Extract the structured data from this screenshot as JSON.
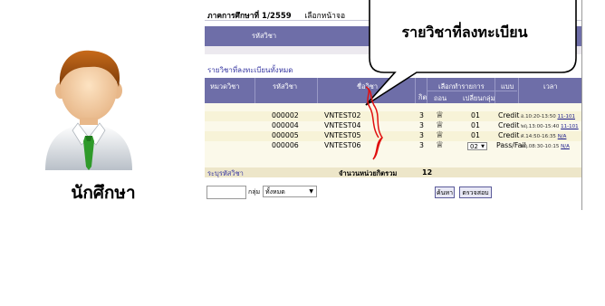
{
  "student": {
    "caption": "นักศึกษา"
  },
  "screen": {
    "term_label": "ภาคการศึกษาที่ 1/2559",
    "term_hint": "เลือกหน้าจอ",
    "top_header": {
      "col_code": "รหัสวิชา"
    },
    "section_title": "รายวิชาที่ลงทะเบียนทั้งหมด",
    "headers": {
      "group": "หมวดวิชา",
      "code": "รหัสวิชา",
      "name": "ชื่อวิชา",
      "credit": "กิต",
      "choose": "เลือกทำรายการ",
      "drop": "ถอน",
      "change_group": "เปลี่ยนกลุ่ม",
      "type": "แบบ",
      "time": "เวลา"
    },
    "rows": [
      {
        "code": "000002",
        "name": "VNTEST02",
        "credit": "3",
        "section": "01",
        "type": "Credit",
        "time_day": "อ.",
        "time": "10:20-13:50",
        "room": "11-101"
      },
      {
        "code": "000004",
        "name": "VNTEST04",
        "credit": "3",
        "section": "01",
        "type": "Credit",
        "time_day": "พฤ.",
        "time": "13:00-15:40",
        "room": "11-101"
      },
      {
        "code": "000005",
        "name": "VNTEST05",
        "credit": "3",
        "section": "01",
        "type": "Credit",
        "time_day": "ศ.",
        "time": "14:50-16:35",
        "room": "N/A"
      },
      {
        "code": "000006",
        "name": "VNTEST06",
        "credit": "3",
        "section": "02",
        "type": "Pass/Fail",
        "time_day": "พฤ.",
        "time": "08:30-10:15",
        "room": "N/A"
      }
    ],
    "footer": {
      "left": "ระบุรหัสวิชา",
      "total_label": "จำนวนหน่วยกิตรวม",
      "total_value": "12"
    },
    "bottom": {
      "group_label": "กลุ่ม",
      "group_select": "ทั้งหมด",
      "search_button": "ค้นหา",
      "check_button": "ตรวจสอบ"
    }
  },
  "callout": {
    "text": "รายวิชาที่ลงทะเบียน"
  },
  "colors": {
    "header": "#6e6ea8",
    "row": "#f7f3d8",
    "bracket": "#e01010",
    "section_title": "#3434a0"
  },
  "icons": {
    "drop": "trash-icon",
    "person": "student-avatar"
  }
}
